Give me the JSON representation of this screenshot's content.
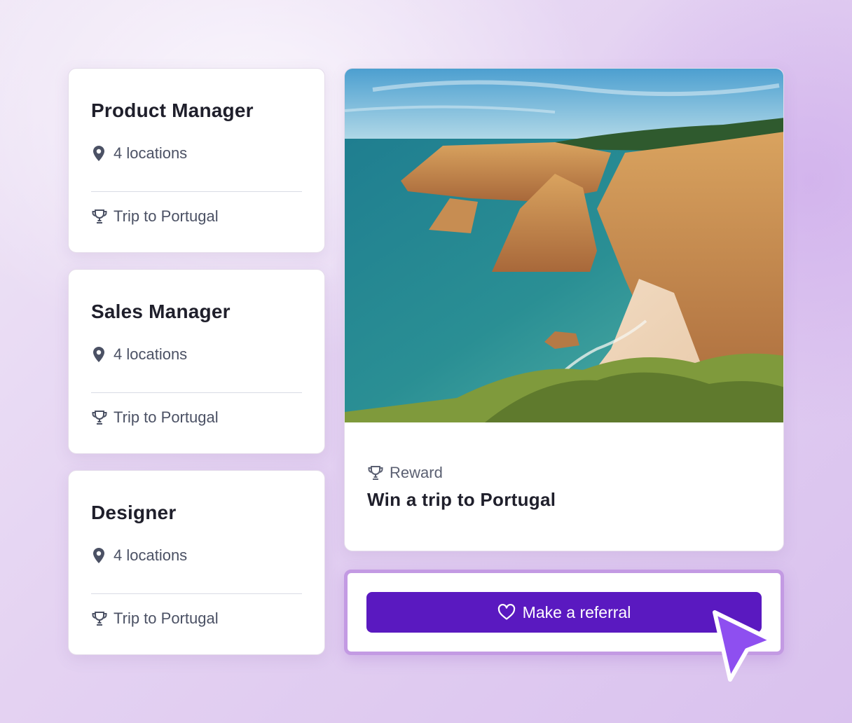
{
  "jobs": [
    {
      "title": "Product Manager",
      "location_icon": "map-pin-icon",
      "locations": "4 locations",
      "reward_icon": "trophy-icon",
      "reward": "Trip to Portugal"
    },
    {
      "title": "Sales Manager",
      "location_icon": "map-pin-icon",
      "locations": "4 locations",
      "reward_icon": "trophy-icon",
      "reward": "Trip to Portugal"
    },
    {
      "title": "Designer",
      "location_icon": "map-pin-icon",
      "locations": "4 locations",
      "reward_icon": "trophy-icon",
      "reward": "Trip to Portugal"
    }
  ],
  "reward_card": {
    "image": "portugal-coastline-photo",
    "label_icon": "trophy-icon",
    "label": "Reward",
    "title": "Win a trip to Portugal"
  },
  "referral": {
    "button_icon": "heart-icon",
    "button_label": "Make a referral",
    "button_color": "#5a19c0",
    "cursor_color": "#8e4ff0"
  },
  "colors": {
    "text_primary": "#1f1f2b",
    "text_secondary": "#4b5164",
    "accent_border": "#c39ae3"
  }
}
